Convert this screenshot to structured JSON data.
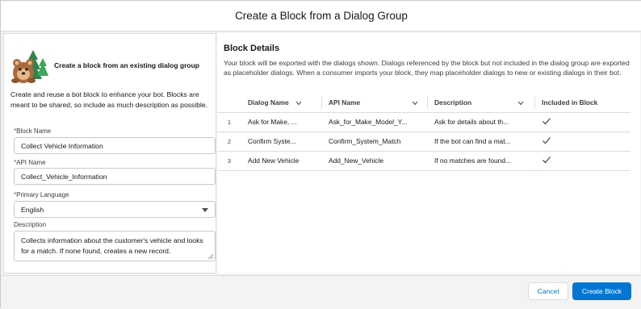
{
  "modal": {
    "title": "Create a Block from a Dialog Group"
  },
  "intro": {
    "heading": "Create a block from an existing dialog group",
    "text": "Create and reuse a bot block to enhance your bot. Blocks are meant to be shared, so include as much description as possible.",
    "mascot_icon": "astro-mascot-icon"
  },
  "form": {
    "block_name": {
      "label": "Block Name",
      "required": "*",
      "value": "Collect Vehicle Information"
    },
    "api_name": {
      "label": "API Name",
      "required": "*",
      "value": "Collect_Vehicle_Information"
    },
    "primary_language": {
      "label": "Primary Language",
      "required": "*",
      "value": "English"
    },
    "description": {
      "label": "Description",
      "value": "Collects information about the customer's vehicle and looks for a match. If none found, creates a new record."
    }
  },
  "details": {
    "title": "Block Details",
    "description": "Your block will be exported with the dialogs shown. Dialogs referenced by the block but not included in the dialog group are exported as placeholder dialogs. When a consumer imports your block, they map placeholder dialogs to new or existing dialogs in their bot."
  },
  "table": {
    "headers": {
      "dialog_name": "Dialog Name",
      "api_name": "API Name",
      "description": "Description",
      "included": "Included in Block"
    },
    "rows": [
      {
        "num": "1",
        "dialog_name": "Ask for Make, ...",
        "api_name": "Ask_for_Make_Model_Y...",
        "description": "Ask for details about th..."
      },
      {
        "num": "2",
        "dialog_name": "Confirm Syste...",
        "api_name": "Confirm_System_Match",
        "description": "If the bot can find a mat..."
      },
      {
        "num": "3",
        "dialog_name": "Add New Vehicle",
        "api_name": "Add_New_Vehicle",
        "description": "If no matches are found..."
      }
    ]
  },
  "footer": {
    "cancel_label": "Cancel",
    "create_label": "Create Block"
  },
  "colors": {
    "brand": "#0176d3",
    "required": "#c23934",
    "border": "#dddbda"
  }
}
